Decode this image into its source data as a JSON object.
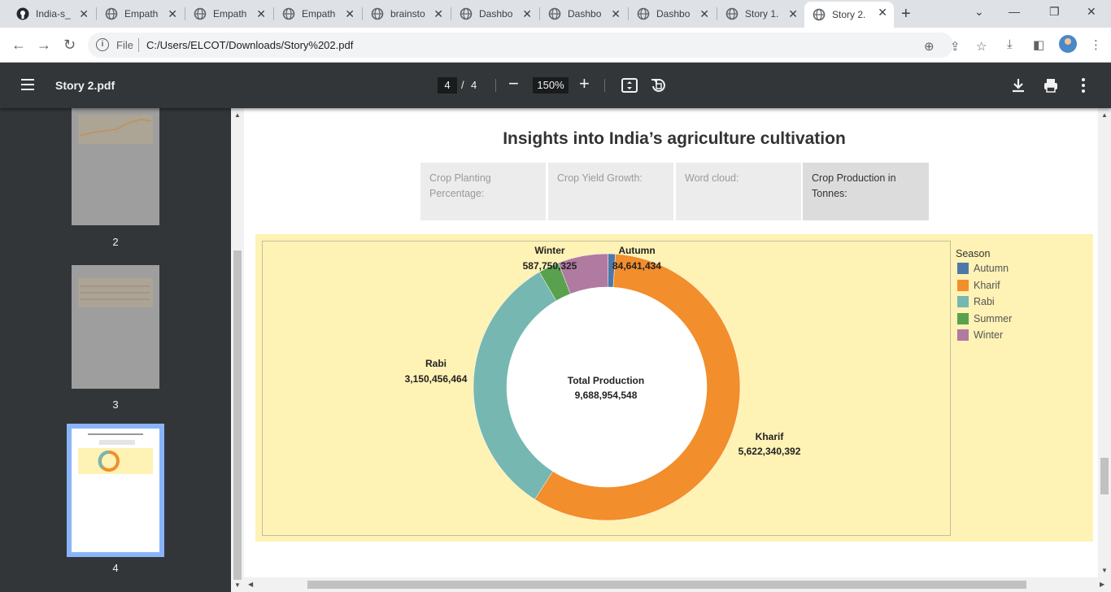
{
  "browser": {
    "tabs": [
      {
        "label": "India-s_",
        "icon": "github-icon",
        "active": false
      },
      {
        "label": "Empath",
        "icon": "globe-icon",
        "active": false
      },
      {
        "label": "Empath",
        "icon": "globe-icon",
        "active": false
      },
      {
        "label": "Empath",
        "icon": "globe-icon",
        "active": false
      },
      {
        "label": "brainsto",
        "icon": "globe-icon",
        "active": false
      },
      {
        "label": "Dashbo",
        "icon": "globe-icon",
        "active": false
      },
      {
        "label": "Dashbo",
        "icon": "globe-icon",
        "active": false
      },
      {
        "label": "Dashbo",
        "icon": "globe-icon",
        "active": false
      },
      {
        "label": "Story 1.",
        "icon": "globe-icon",
        "active": false
      },
      {
        "label": "Story 2.",
        "icon": "globe-icon",
        "active": true
      }
    ],
    "address": {
      "scheme_label": "File",
      "url": "C:/Users/ELCOT/Downloads/Story%202.pdf"
    }
  },
  "pdf_viewer": {
    "title": "Story 2.pdf",
    "current_page": "4",
    "page_separator": "/",
    "total_pages": "4",
    "zoom": "150%",
    "thumbnails": [
      {
        "number": "2"
      },
      {
        "number": "3"
      },
      {
        "number": "4"
      }
    ]
  },
  "dashboard": {
    "title": "Insights into India’s agriculture cultivation",
    "story_tabs": [
      {
        "label": "Crop Planting Percentage:",
        "active": false
      },
      {
        "label": "Crop Yield Growth:",
        "active": false
      },
      {
        "label": "Word cloud:",
        "active": false
      },
      {
        "label": "Crop Production in Tonnes:",
        "active": true
      }
    ],
    "legend_title": "Season",
    "center_label": "Total Production",
    "center_value": "9,688,954,548"
  },
  "chart_data": {
    "type": "pie",
    "categories": [
      "Autumn",
      "Kharif",
      "Rabi",
      "Summer",
      "Winter"
    ],
    "values": [
      84641434,
      5622340392,
      3150456464,
      243766258,
      587750325
    ],
    "value_labels": [
      "84,641,434",
      "5,622,340,392",
      "3,150,456,464",
      "",
      "587,750,325"
    ],
    "colors": {
      "Autumn": "#4e79a7",
      "Kharif": "#f28e2b",
      "Rabi": "#76b7b2",
      "Summer": "#59a14f",
      "Winter": "#b07aa1"
    },
    "title": "Insights into India’s agriculture cultivation",
    "legend_title": "Season",
    "legend_position": "right",
    "donut": true
  }
}
